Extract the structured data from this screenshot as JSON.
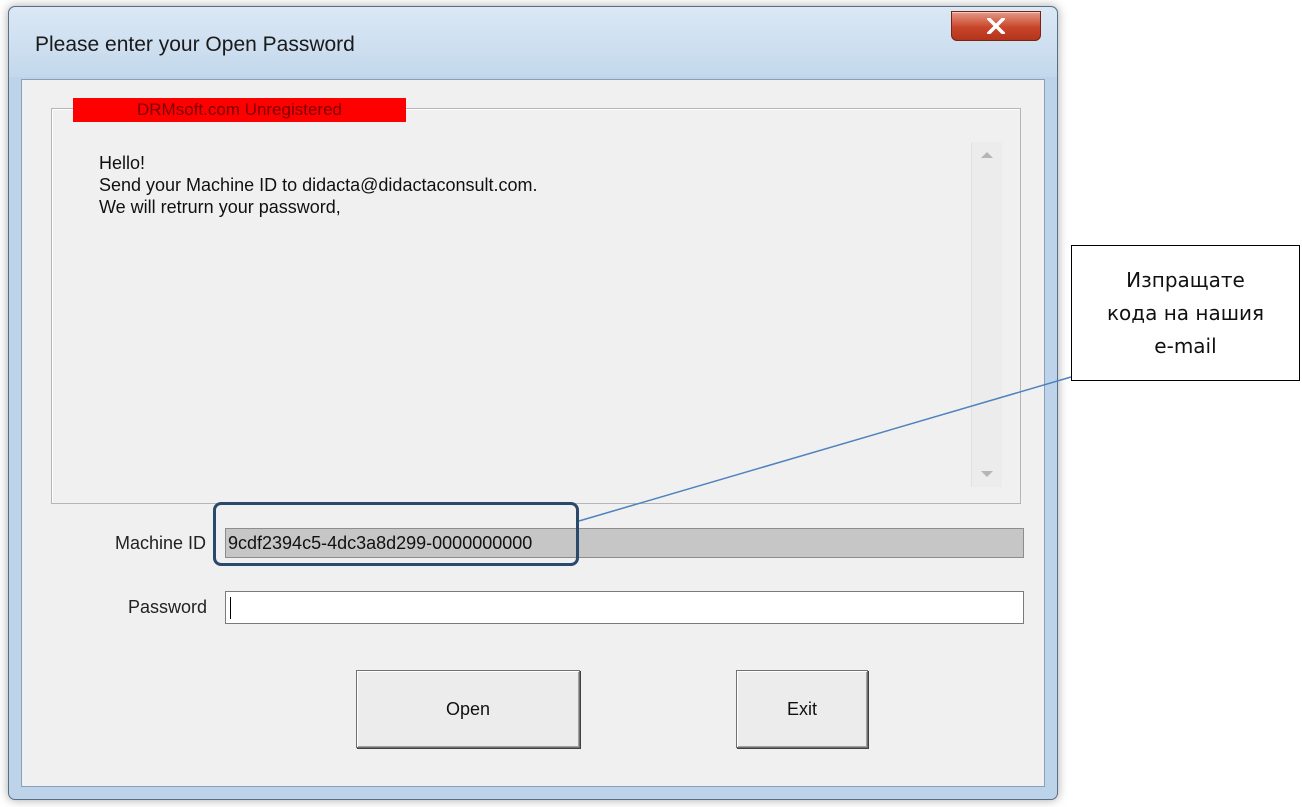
{
  "window": {
    "title": "Please enter your Open Password"
  },
  "group": {
    "label": "DRMsoft.com Unregistered",
    "label_color": "#ff0000",
    "message_lines": [
      "Hello!",
      "Send your Machine ID to didacta@didactaconsult.com.",
      "We will retrurn your password,"
    ]
  },
  "machine_id": {
    "label": "Machine ID",
    "value": "9cdf2394c5-4dc3a8d299-0000000000"
  },
  "password": {
    "label": "Password",
    "value": ""
  },
  "buttons": {
    "open": "Open",
    "exit": "Exit"
  },
  "callout": {
    "lines": [
      "Изпращате",
      "кода на нашия",
      "e-mail"
    ],
    "line_color": "#4f81bd",
    "highlight_color": "#2b4a6b"
  }
}
